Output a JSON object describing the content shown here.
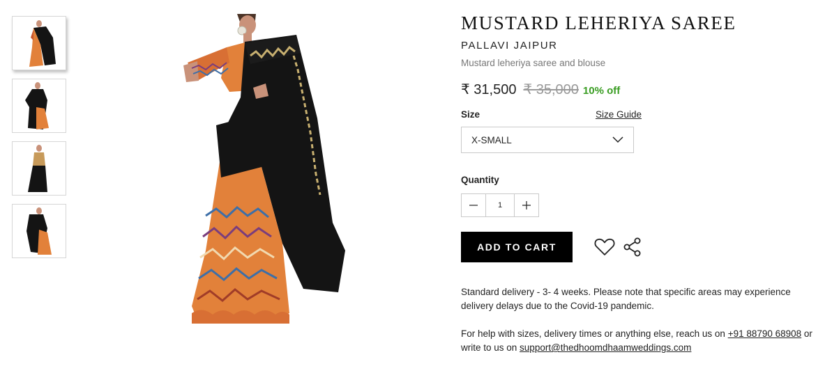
{
  "product": {
    "title": "MUSTARD LEHERIYA SAREE",
    "brand": "PALLAVI JAIPUR",
    "subtitle": "Mustard leheriya saree and blouse",
    "price": "₹ 31,500",
    "mrp": "₹ 35,000",
    "discount": "10% off"
  },
  "size": {
    "label": "Size",
    "guide_label": "Size Guide",
    "selected": "X-SMALL"
  },
  "quantity": {
    "label": "Quantity",
    "value": "1"
  },
  "actions": {
    "add_to_cart": "ADD TO CART"
  },
  "delivery_note": "Standard delivery - 3- 4 weeks. Please note that specific areas may experience delivery delays due to the Covid-19 pandemic.",
  "help": {
    "text_before": "For help with sizes, delivery times or anything else, reach us on ",
    "phone": "+91 88790 68908",
    "text_middle": " or write to us on ",
    "email": "support@thedhoomdhaamweddings.com"
  },
  "icons": {
    "wishlist": "heart-icon",
    "share": "share-icon",
    "dropdown": "chevron-down-icon",
    "minus": "minus-icon",
    "plus": "plus-icon"
  },
  "colors": {
    "discount": "#3a9d23",
    "button": "#000000",
    "saree_black": "#141414",
    "saree_orange": "#e2813a"
  }
}
